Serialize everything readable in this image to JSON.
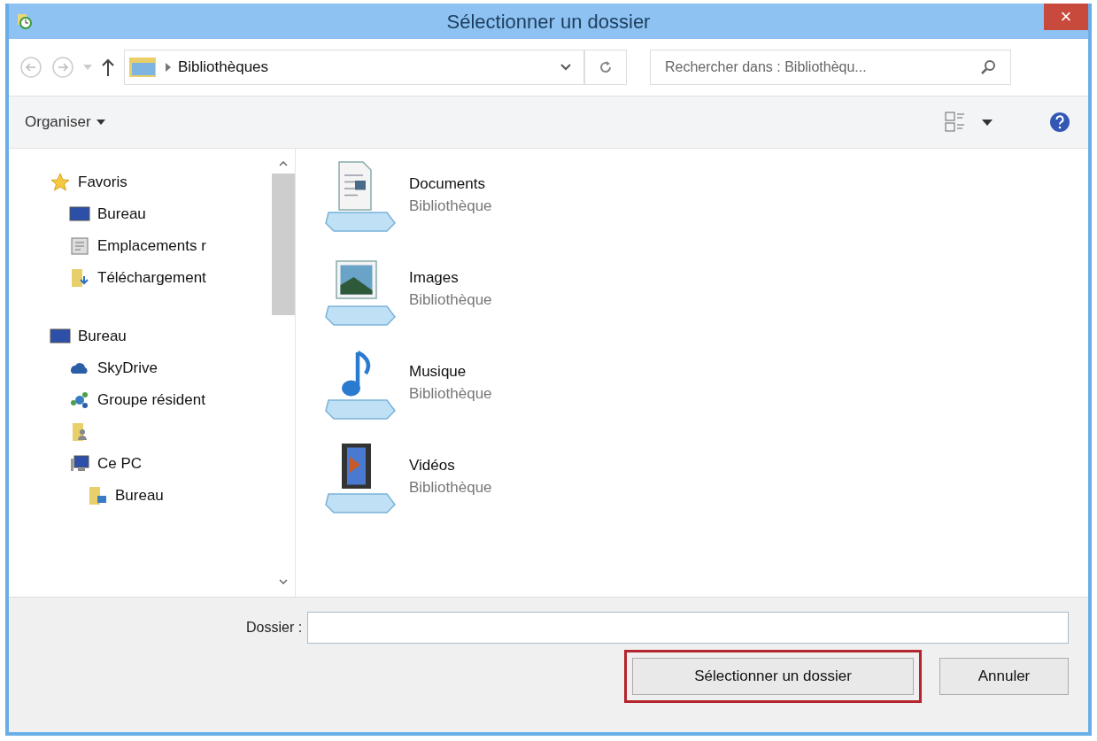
{
  "window": {
    "title": "Sélectionner un dossier",
    "close": "×"
  },
  "address_bar": {
    "path": "Bibliothèques"
  },
  "search": {
    "placeholder": "Rechercher dans : Bibliothèqu..."
  },
  "toolbar": {
    "organize": "Organiser"
  },
  "sidebar": {
    "items": [
      {
        "label": "Favoris",
        "kind": "star",
        "children": [
          {
            "label": "Bureau",
            "kind": "desktop"
          },
          {
            "label": "Emplacements r",
            "kind": "recent"
          },
          {
            "label": "Téléchargement",
            "kind": "download"
          }
        ]
      },
      {
        "label": "Bureau",
        "kind": "desktop",
        "children": [
          {
            "label": "SkyDrive",
            "kind": "cloud"
          },
          {
            "label": "Groupe résident",
            "kind": "homegroup"
          },
          {
            "kind": "user"
          },
          {
            "label": "Ce PC",
            "kind": "pc",
            "children": [
              {
                "label": "Bureau",
                "kind": "folder"
              }
            ]
          }
        ]
      }
    ]
  },
  "libraries": [
    {
      "name": "Documents",
      "type": "Bibliothèque",
      "kind": "documents"
    },
    {
      "name": "Images",
      "type": "Bibliothèque",
      "kind": "images"
    },
    {
      "name": "Musique",
      "type": "Bibliothèque",
      "kind": "music"
    },
    {
      "name": "Vidéos",
      "type": "Bibliothèque",
      "kind": "videos"
    }
  ],
  "folder_field": {
    "label": "Dossier :"
  },
  "buttons": [
    {
      "label": "Sélectionner un dossier",
      "highlighted": true
    },
    {
      "label": "Annuler",
      "highlighted": false
    }
  ]
}
